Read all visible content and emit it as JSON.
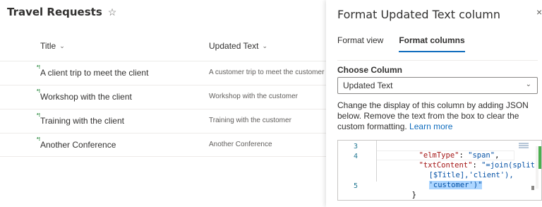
{
  "list": {
    "title": "Travel Requests",
    "star_glyph": "☆",
    "columns": {
      "title": "Title",
      "updated": "Updated Text"
    },
    "rows": [
      {
        "title": "A client trip to meet the client",
        "updated": "A customer trip to meet the customer"
      },
      {
        "title": "Workshop with the client",
        "updated": "Workshop with the customer"
      },
      {
        "title": "Training with the client",
        "updated": "Training with the customer"
      },
      {
        "title": "Another Conference",
        "updated": "Another Conference"
      }
    ],
    "new_badge": "*!"
  },
  "panel": {
    "title": "Format Updated Text column",
    "close_glyph": "×",
    "tabs": [
      {
        "label": "Format view",
        "active": false
      },
      {
        "label": "Format columns",
        "active": true
      }
    ],
    "choose_label": "Choose Column",
    "select_value": "Updated Text",
    "description": "Change the display of this column by adding JSON below. Remove the text from the box to clear the custom formatting.",
    "learn_more": "Learn more"
  },
  "editor": {
    "lines": [
      {
        "num": "3",
        "text_key": "\"elmType\"",
        "text_sep": ": ",
        "text_val": "\"span\"",
        "text_end": ","
      },
      {
        "num": "4",
        "text_key": "\"txtContent\"",
        "text_sep": ": ",
        "text_val": "\"=join(split(",
        "text_end": ""
      },
      {
        "num": "",
        "text": "[$Title],'client'),"
      },
      {
        "num": "",
        "text": "'customer')\""
      },
      {
        "num": "5",
        "text": "}"
      }
    ]
  },
  "colors": {
    "accent": "#0f6cbd",
    "new_icon": "#2a8a3e"
  }
}
